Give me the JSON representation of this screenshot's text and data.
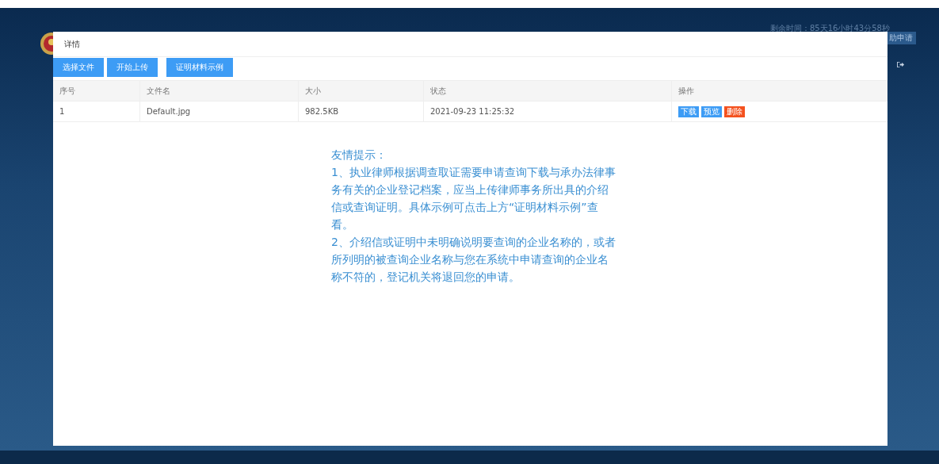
{
  "background": {
    "countdown": "剩余时间：85天16小时43分58秒",
    "side_button": "助申请"
  },
  "modal": {
    "title": "详情",
    "toolbar": [
      {
        "label": "选择文件"
      },
      {
        "label": "开始上传"
      },
      {
        "label": "证明材料示例"
      }
    ],
    "table": {
      "columns": [
        "序号",
        "文件名",
        "大小",
        "状态",
        "操作"
      ],
      "rows": [
        {
          "cells": [
            "1",
            "Default.jpg",
            "982.5KB",
            "2021-09-23 11:25:32"
          ],
          "actions": [
            {
              "label": "下载",
              "kind": "primary"
            },
            {
              "label": "预览",
              "kind": "primary"
            },
            {
              "label": "删除",
              "kind": "danger"
            }
          ]
        }
      ]
    },
    "tip": {
      "heading": "友情提示：",
      "paragraphs": [
        "1、执业律师根据调查取证需要申请查询下载与承办法律事务有关的企业登记档案，应当上传律师事务所出具的介绍信或查询证明。具体示例可点击上方“证明材料示例”查看。",
        "2、介绍信或证明中未明确说明要查询的企业名称的，或者所列明的被查询企业名称与您在系统中申请查询的企业名称不符的，登记机关将退回您的申请。"
      ]
    }
  }
}
